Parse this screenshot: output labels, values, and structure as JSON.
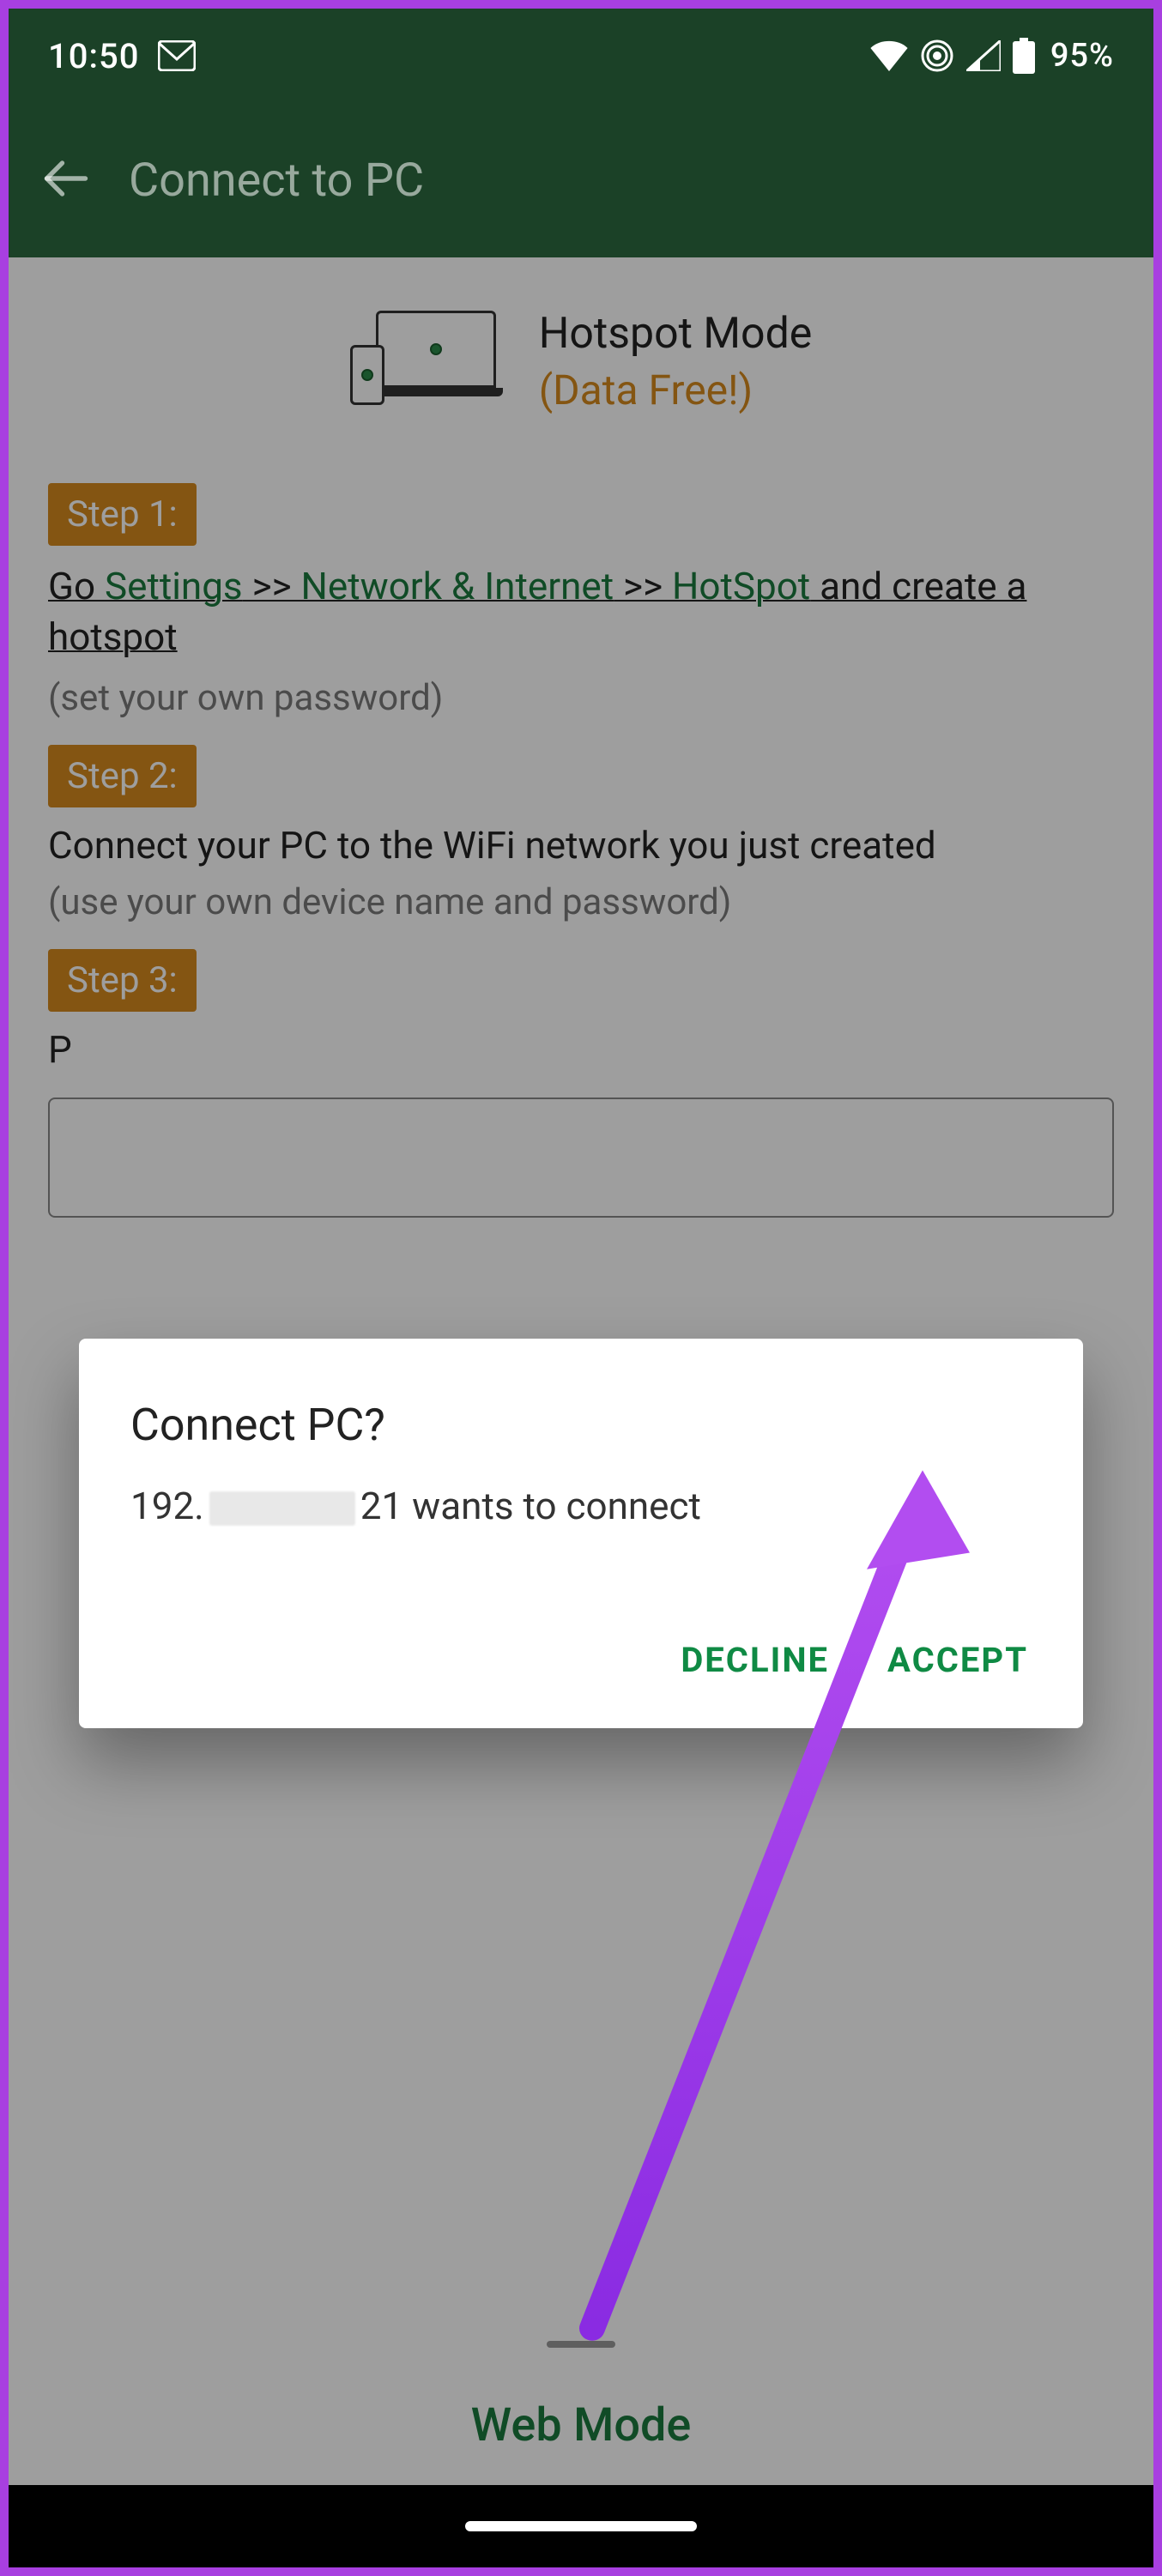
{
  "statusbar": {
    "time": "10:50",
    "battery_pct": "95%"
  },
  "appbar": {
    "title": "Connect to PC"
  },
  "mode": {
    "title": "Hotspot Mode",
    "subtitle": "(Data Free!)"
  },
  "steps": {
    "s1_label": "Step 1:",
    "s1_go": "Go ",
    "s1_settings": "Settings",
    "s1_sep1": " >> ",
    "s1_network": "Network & Internet",
    "s1_sep2": " >> ",
    "s1_hotspot": "HotSpot",
    "s1_tail": " and create a hotspot",
    "s1_note": "(set your own password)",
    "s2_label": "Step 2:",
    "s2_text": "Connect your PC to the WiFi network you just created",
    "s2_note": "(use your own device name and password)",
    "s3_label": "Step 3:",
    "s3_text_prefix": "P"
  },
  "web_mode_label": "Web Mode",
  "dialog": {
    "title": "Connect PC?",
    "msg_ip_prefix": "192.",
    "msg_ip_suffix": "21 wants to connect",
    "decline": "DECLINE",
    "accept": "ACCEPT"
  }
}
